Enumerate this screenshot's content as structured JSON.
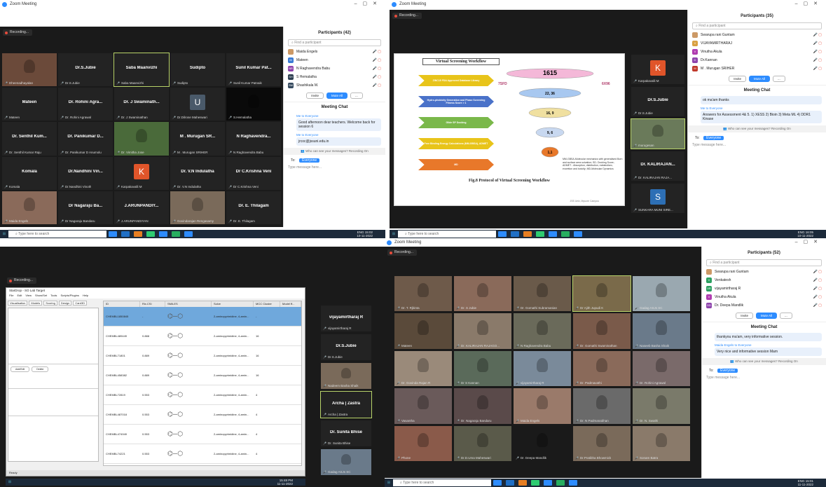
{
  "q1": {
    "title": "Zoom Meeting",
    "recording": "Recording...",
    "tiles": [
      {
        "name": "",
        "label": "Dheenadhayalan",
        "video": "#6b4a3a"
      },
      {
        "name": "Dr.S.Jubie",
        "label": "Dr.S.Jubie"
      },
      {
        "name": "Saba Maanvizhi",
        "label": "Saba Maanvizhi",
        "active": true
      },
      {
        "name": "Sudipto",
        "label": "Sudipto"
      },
      {
        "name": "Sunil Kumar Pat...",
        "label": "Sunil Kumar Patnaik"
      },
      {
        "name": "Mateen",
        "label": "Mateen"
      },
      {
        "name": "Dr. Rohini Agra...",
        "label": "Dr. Rohini Agrawal"
      },
      {
        "name": "Dr. J Swaminath...",
        "label": "Dr. J Swaminathan"
      },
      {
        "name": "",
        "label": "Dr.Dilrose Maheswari",
        "avatar": "U",
        "avcolor": "#4a5a6a"
      },
      {
        "name": "",
        "label": "S.Hemalatha",
        "video": "#0a0a0a"
      },
      {
        "name": "Dr. Senthil Kum...",
        "label": "Dr. Senthil Kumar Raju"
      },
      {
        "name": "Dr. Panikumar D...",
        "label": "Dr. Panikumar D Anumolu"
      },
      {
        "name": "",
        "label": "Dr. Vimitha Jose",
        "video": "#4a6a3a"
      },
      {
        "name": "M . Murugan SR...",
        "label": "M . Murugan SRIHER"
      },
      {
        "name": "N Raghavendra...",
        "label": "N Raghavendra Babu"
      },
      {
        "name": "Komala",
        "label": "Komala"
      },
      {
        "name": "Dr.Nandhini Vin...",
        "label": "Dr.Nandhini Vinoth"
      },
      {
        "name": "",
        "label": "Karpakavalli M",
        "avatar": "K",
        "avcolor": "#e0552a"
      },
      {
        "name": "Dr. V.N Indulatha",
        "label": "Dr. V.N Indulatha"
      },
      {
        "name": "Dr C.Krishna Veni",
        "label": "Dr C.Krishna Veni"
      },
      {
        "name": "",
        "label": "Maida Engels",
        "video": "#8a6a5a"
      },
      {
        "name": "Dr Nagaraju Ba...",
        "label": "Dr Nagaraju Bandaru"
      },
      {
        "name": "J.ARUNPANDIY...",
        "label": "J.ARUNPANDIYAN"
      },
      {
        "name": "",
        "label": "Govindarajan Rengasamy",
        "video": "#7a6a5a"
      },
      {
        "name": "Dr. E. Thilagam",
        "label": "Dr. E. Thilagam"
      }
    ],
    "panel": {
      "title": "Participants (42)",
      "search": "Find a participant",
      "people": [
        {
          "name": "Maida Engels",
          "av": "#c96",
          "initial": ""
        },
        {
          "name": "Mateen",
          "av": "#3a7bd5",
          "initial": "M"
        },
        {
          "name": "N Raghavendra Babu",
          "av": "#8e44ad",
          "initial": "NR"
        },
        {
          "name": "S Hemalatha",
          "av": "#2c3e50",
          "initial": "SH"
        },
        {
          "name": "Shashikala M.",
          "av": "#34495e",
          "initial": "SM"
        }
      ],
      "invite": "Invite",
      "muteall": "Mute All",
      "more": "...",
      "chat_title": "Meeting Chat",
      "msgs": [
        {
          "from": "Me to Everyone",
          "text": "Good afternoon dear teachers. Welcome back for session 6"
        },
        {
          "from": "Me to Everyone",
          "text": "jrcoc@jssuni.edu.in"
        }
      ],
      "who": "Who can see your messages? Recording On",
      "to": "To:",
      "everyone": "Everyone",
      "type": "Type message here..."
    },
    "taskbar": {
      "search": "Type here to search",
      "time": "15:02",
      "date": "10-11-2022",
      "lang": "ENG"
    }
  },
  "q2": {
    "title": "Zoom Meeting",
    "recording": "Recording...",
    "slide": {
      "title": "Virtual Screening Workflow",
      "steps": [
        "ZINC15 FDA Approved Database Library",
        "Hydro-phobicity Generation and Phase Screening Fitness Score > 1",
        "Glide SP Docking",
        "Free Binding Energy Calculations (MM-GBSA), ADMET",
        "MD"
      ],
      "funnel": [
        "1615",
        "22, 36",
        "16, 9",
        "9, 6",
        "1,1"
      ],
      "left": "7SFD",
      "right": "6X96",
      "caption": "Fig.8 Protocol of Virtual Screening Workflow",
      "notes": "MM-GBSA-Molecular mechanics with generalised Born and surface area solvation; SD- Docking Score; ADMET - Absorption, distribution, metabolism, excretion and toxicity; MD-Molecular Dynamics",
      "footer": "JSS Univ, Mysore Campus"
    },
    "side": [
      {
        "label": "Karpakavalli M",
        "avatar": "K",
        "avcolor": "#e0552a"
      },
      {
        "name": "Dr.S.Jubie",
        "label": "Dr.S.Jubie"
      },
      {
        "label": "murugesan",
        "video": "#6a7a5a",
        "active": true
      },
      {
        "name": "Dr. KALIRAJAN...",
        "label": "Dr. KALIRAJAN RAJA..."
      },
      {
        "label": "SUNKARA MUNI SIRE...",
        "avatar": "S",
        "avcolor": "#2d6fb5"
      }
    ],
    "panel": {
      "title": "Participants (35)",
      "search": "Find a participant",
      "people": [
        {
          "name": "Swarupa rani Guntam",
          "av": "#c96",
          "initial": ""
        },
        {
          "name": "VIJAYAMIRTHARAJ",
          "av": "#d9a040",
          "initial": "V"
        },
        {
          "name": "Vinutha Akula",
          "av": "#b03cb0",
          "initial": "V"
        },
        {
          "name": "Dr.Kannan",
          "av": "#8e44ad",
          "initial": "D"
        },
        {
          "name": "M . Murugan SRIHER",
          "av": "#c0392b",
          "initial": "M"
        }
      ],
      "invite": "Invite",
      "muteall": "Mute All",
      "more": "...",
      "chat_title": "Meeting Chat",
      "msgs": [
        {
          "from": "",
          "text": "ok ma'am thanks"
        },
        {
          "from": "Me to Everyone",
          "text": "Answers for Assessment 4& 5. 1) XESS 2) Bioin 3) Meta ML 4) DDR1 Kinase"
        }
      ],
      "who": "Who can see your messages? Recording On",
      "to": "To:",
      "everyone": "Everyone",
      "type": "Type message here..."
    },
    "taskbar": {
      "search": "Type here to search",
      "time": "16:05",
      "date": "10-11-2022",
      "lang": "ENG"
    }
  },
  "q3": {
    "recording": "Recording...",
    "app": {
      "title": "StarDrop - SO Lab Target",
      "menus": [
        "File",
        "Edit",
        "View",
        "Show/Set",
        "Tools",
        "Scripts/Plugins",
        "Help"
      ],
      "tabs": [
        "Visualisation",
        "Models",
        "Scoring",
        "Design",
        "Card3D"
      ],
      "cols": [
        "ID",
        "Rix.CSI",
        "SMILES",
        "Solve",
        "MCC Cluster",
        "Model ff..."
      ],
      "rows": [
        [
          "CHEMBL1850845",
          "-",
          "2-aminopyrimidine, 4-amin...",
          "-"
        ],
        [
          "CHEMBL489449",
          "0.888",
          "2-aminopyrimidine, 4-amin...",
          "16"
        ],
        [
          "CHEMBL71801",
          "0.889",
          "2-aminopyrimidine, 4-amin...",
          "16"
        ],
        [
          "CHEMBL458382",
          "0.889",
          "2-aminopyrimidine, 4-amin...",
          "16"
        ],
        [
          "CHEMBL72819",
          "0.553",
          "2-aminopyrimidine, 4-amin...",
          "4"
        ],
        [
          "CHEMBL487018",
          "0.553",
          "2-aminopyrimidine, 4-amin...",
          "4"
        ],
        [
          "CHEMBL474949",
          "0.553",
          "2-aminopyrimidine, 4-amin...",
          "4"
        ],
        [
          "CHEMBL74221",
          "0.553",
          "2-aminopyrimidine, 4-amin...",
          "4"
        ]
      ],
      "status": "Ready"
    },
    "side": [
      {
        "name": "vijayamirtharaj R",
        "label": "vijayamirtharaj R"
      },
      {
        "name": "Dr.S.Jubie",
        "label": "Dr.S.Jubie"
      },
      {
        "label": "Nadeem Basha Shaik",
        "video": "#7a6a5a"
      },
      {
        "name": "Archa | Zastra",
        "label": "Archa | Zastra",
        "active": true
      },
      {
        "name": "Dr. Sunita Bhise",
        "label": "Dr. Sunita Bhise"
      },
      {
        "label": "Gadag ASJs SC",
        "video": "#6a7a8a"
      }
    ],
    "taskbar": {
      "time": "15:48 PM",
      "date": "11-11-2022"
    }
  },
  "q4": {
    "title": "Zoom Meeting",
    "recording": "Recording...",
    "tiles": [
      {
        "label": "Dr. T. Rjbinta",
        "video": "#6e5a4a"
      },
      {
        "label": "Dr. S Jubie",
        "video": "#8a6a5a"
      },
      {
        "label": "Dr. Gomathi Subramanian",
        "video": "#6a5a4a"
      },
      {
        "label": "Dr Ajith Jupudi K",
        "video": "#7a6a4a",
        "active": true
      },
      {
        "label": "Gadag ASJs SC",
        "video": "#9aa8b0"
      },
      {
        "label": "Mateen",
        "video": "#5a4a3a"
      },
      {
        "label": "Dr. KALIRAJAN RAJAGO...",
        "video": "#8a7a6a"
      },
      {
        "label": "N Raghavendra Babu",
        "video": "#6a6a5a"
      },
      {
        "label": "Dr. Gomathi Swaminathan",
        "video": "#7a5a4a"
      },
      {
        "label": "Naseeb Basha Shaik",
        "video": "#6a7a8a"
      },
      {
        "label": "Dr. Govinda Rajan R",
        "video": "#9a8a7a"
      },
      {
        "label": "Dr S Kannan",
        "video": "#5a6a5a"
      },
      {
        "label": "vijayamirtharaj R",
        "video": "#7a8a9a"
      },
      {
        "label": "Dr. Padmavathi",
        "video": "#8a6a5a"
      },
      {
        "label": "Dr. Rohini Agrawal",
        "video": "#7a6a6a"
      },
      {
        "label": "Vasantha",
        "video": "#6a5a5a"
      },
      {
        "label": "Dr. Nagaraju Bandaru",
        "video": "#5a4a4a"
      },
      {
        "label": "Maida Engels",
        "video": "#9a7a6a"
      },
      {
        "label": "Dr. N Padmanabhan",
        "video": "#6a6a6a"
      },
      {
        "label": "Dr. N. Swathi",
        "video": "#7a7a6a"
      },
      {
        "label": "Phone",
        "video": "#8a5a4a"
      },
      {
        "label": "Dr.D.Uma Maheswari",
        "video": "#5a5a4a"
      },
      {
        "label": "Dr. Deepa Mandlik",
        "avatar": "",
        "video": "#1a1a1a"
      },
      {
        "label": "Dr.Pratibha Bhowmick",
        "video": "#7a6a5a"
      },
      {
        "label": "Sonam Batra",
        "video": "#8a7a6a"
      }
    ],
    "panel": {
      "title": "Participants (52)",
      "search": "Find a participant",
      "people": [
        {
          "name": "Swarupa rani Guntam",
          "av": "#c96",
          "initial": ""
        },
        {
          "name": "Venkatesh",
          "av": "#2ca060",
          "initial": "V"
        },
        {
          "name": "vijayamirtharaj R",
          "av": "#2ca060",
          "initial": "VR"
        },
        {
          "name": "Vinutha Akula",
          "av": "#b03cb0",
          "initial": "V"
        },
        {
          "name": "Dr. Deepa Mandlik",
          "av": "#8e44ad",
          "initial": "DD"
        }
      ],
      "invite": "Invite",
      "muteall": "Mute All",
      "more": "...",
      "chat_title": "Meeting Chat",
      "msgs": [
        {
          "from": "",
          "text": "thankyou ma'am, very informative session."
        },
        {
          "from": "Maida Engels to Everyone",
          "text": "Very nice and informative session Mam"
        }
      ],
      "who": "Who can see your messages? Recording On",
      "to": "To:",
      "everyone": "Everyone",
      "type": "Type message here..."
    },
    "taskbar": {
      "search": "Type here to search",
      "time": "15:01",
      "date": "11-11-2022",
      "lang": "ENG"
    }
  }
}
